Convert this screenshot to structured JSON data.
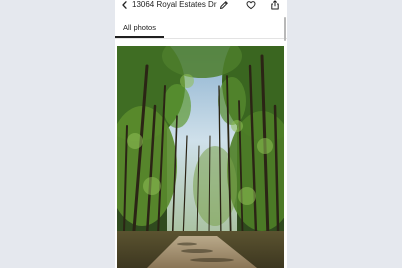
{
  "header": {
    "title": "13064 Royal Estates Dr",
    "back_icon": "chevron-left-icon",
    "edit_icon": "pencil-icon",
    "favorite_icon": "heart-icon",
    "share_icon": "share-icon"
  },
  "tabs": [
    {
      "label": "All photos",
      "active": true
    }
  ],
  "photo": {
    "subject": "tree-lined dirt road",
    "accent_color": "#2f6a1f"
  },
  "colors": {
    "background": "#e5e8ee",
    "panel": "#ffffff",
    "text": "#222222"
  }
}
